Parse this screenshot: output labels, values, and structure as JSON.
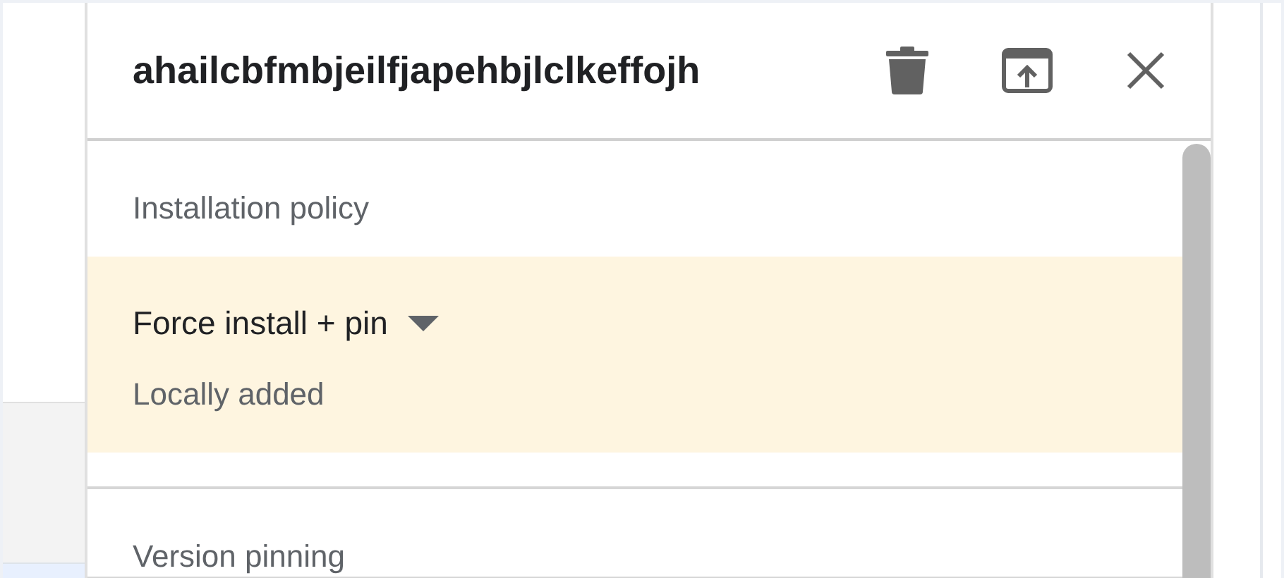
{
  "dialog": {
    "title": "ahailcbfmbjeilfjapehbjlclkeffojh",
    "sections": [
      {
        "label": "Installation policy",
        "policy": {
          "value": "Force install + pin",
          "source": "Locally added",
          "highlighted": true
        }
      },
      {
        "label": "Version pinning"
      }
    ]
  }
}
